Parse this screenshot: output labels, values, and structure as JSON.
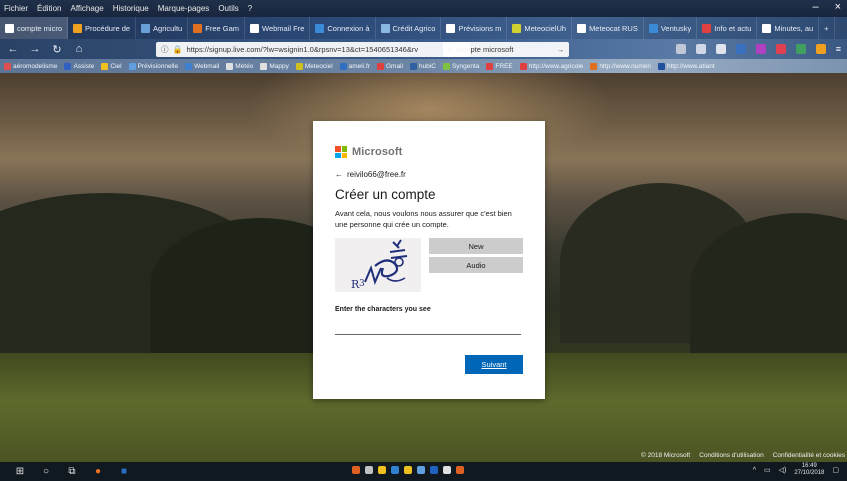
{
  "menubar": {
    "items": [
      "Fichier",
      "Édition",
      "Affichage",
      "Historique",
      "Marque-pages",
      "Outils",
      "?"
    ]
  },
  "window_controls": {
    "minimize": "–",
    "close": "×"
  },
  "tabs": [
    {
      "label": "compte micro",
      "color": "#ffffff"
    },
    {
      "label": "Procédure de",
      "color": "#f0a020"
    },
    {
      "label": "Agricultu",
      "color": "#6aa0d8"
    },
    {
      "label": "Free Gam",
      "color": "#e07020"
    },
    {
      "label": "Webmail Fre",
      "color": "#ffffff"
    },
    {
      "label": "Connexion à",
      "color": "#3a8ad8"
    },
    {
      "label": "Crédit Agrico",
      "color": "#8ab8e0"
    },
    {
      "label": "Prévisions m",
      "color": "#ffffff"
    },
    {
      "label": "MeteocielUh",
      "color": "#d0d030"
    },
    {
      "label": "Meteocat RUS",
      "color": "#ffffff"
    },
    {
      "label": "Ventusky",
      "color": "#3a8ad8"
    },
    {
      "label": "Info et actu",
      "color": "#e04040"
    },
    {
      "label": "Minutes, au",
      "color": "#ffffff"
    }
  ],
  "nav": {
    "url": "https://signup.live.com/?lw=wsignin1.0&rpsnv=13&ct=1540651346&rv",
    "search_value": "compte microsoft",
    "url_icon_more": "···",
    "url_icon_bookmark": "☆"
  },
  "bookmarks": [
    {
      "label": "aéromodelisme",
      "color": "#e05050"
    },
    {
      "label": "Assiste",
      "color": "#3060c0"
    },
    {
      "label": "Ciel",
      "color": "#f0c020"
    },
    {
      "label": "Prévisionnelle",
      "color": "#60a0e0"
    },
    {
      "label": "Webmail",
      "color": "#4080d0"
    },
    {
      "label": "Météo",
      "color": "#e0e0e0"
    },
    {
      "label": "Mappy",
      "color": "#e0e0e0"
    },
    {
      "label": "Meteociel",
      "color": "#d0c020"
    },
    {
      "label": "ameli.fr",
      "color": "#3070c0"
    },
    {
      "label": "Gmail",
      "color": "#e04040"
    },
    {
      "label": "hubiC",
      "color": "#3060a0"
    },
    {
      "label": "Syngenta",
      "color": "#80c040"
    },
    {
      "label": "FREE",
      "color": "#e04040"
    },
    {
      "label": "http://www.agricole",
      "color": "#e04040"
    },
    {
      "label": "http://www.numeri",
      "color": "#e07020"
    },
    {
      "label": "http://www.atlant",
      "color": "#2050a0"
    }
  ],
  "dialog": {
    "brand": "Microsoft",
    "identity": "reivilo66@free.fr",
    "back_arrow": "←",
    "heading": "Créer un compte",
    "description": "Avant cela, nous voulons nous assurer que c'est bien une personne qui crée un compte.",
    "new_button": "New",
    "audio_button": "Audio",
    "enter_label": "Enter the characters you see",
    "input_value": "",
    "next_button": "Suivant"
  },
  "footer": {
    "copyright": "© 2018 Microsoft",
    "terms": "Conditions d'utilisation",
    "privacy": "Confidentialité et cookies"
  },
  "taskbar": {
    "time": "16:49",
    "date": "27/10/2018"
  },
  "colors": {
    "ms_blue": "#0067b8",
    "captcha_button": "#cccccc"
  }
}
